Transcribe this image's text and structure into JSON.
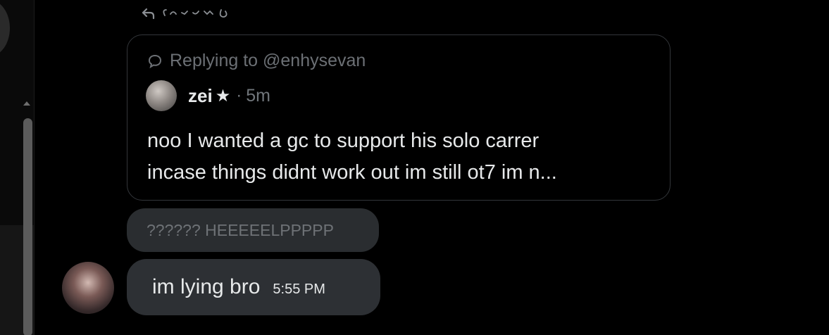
{
  "quoted_post": {
    "replying_label": "Replying to @enhysevan",
    "author": "zei",
    "author_badge_icon": "star",
    "separator": "·",
    "time_ago": "5m",
    "text_line1": "noo I  wanted a gc to support his solo carrer",
    "text_line2": "incase things didnt work out im still ot7 im n..."
  },
  "messages": [
    {
      "text": "?????? HEEEEELPPPPP"
    },
    {
      "text": "im lying bro",
      "time": "5:55 PM"
    }
  ],
  "colors": {
    "background": "#000000",
    "text_primary": "#e7e9ea",
    "text_muted": "#71767b",
    "bubble_dark": "#2d3034",
    "bubble_gray": "#2a2d30",
    "card_border": "#33363a"
  },
  "icons": {
    "top_reply": "reply-arrow-icon",
    "replying": "speech-bubble-icon",
    "badge": "star-icon"
  }
}
